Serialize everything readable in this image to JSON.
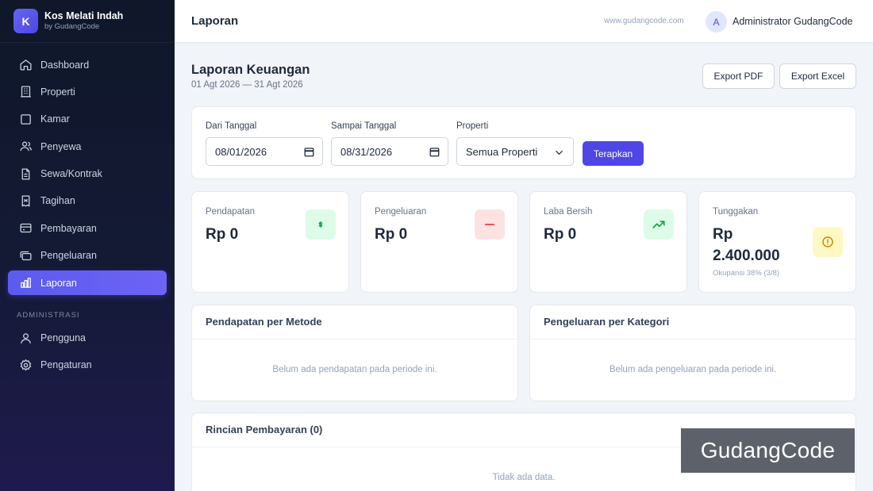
{
  "brand": {
    "logo_letter": "K",
    "name": "Kos Melati Indah",
    "sub": "by GudangCode"
  },
  "nav": {
    "items": [
      {
        "label": "Dashboard",
        "icon": "home-icon"
      },
      {
        "label": "Properti",
        "icon": "building-icon"
      },
      {
        "label": "Kamar",
        "icon": "square-icon"
      },
      {
        "label": "Penyewa",
        "icon": "users-icon"
      },
      {
        "label": "Sewa/Kontrak",
        "icon": "document-icon"
      },
      {
        "label": "Tagihan",
        "icon": "receipt-icon"
      },
      {
        "label": "Pembayaran",
        "icon": "credit-card-icon"
      },
      {
        "label": "Pengeluaran",
        "icon": "wallet-icon"
      },
      {
        "label": "Laporan",
        "icon": "bar-chart-icon",
        "active": true
      }
    ],
    "section_admin": "ADMINISTRASI",
    "admin_items": [
      {
        "label": "Pengguna",
        "icon": "user-icon"
      },
      {
        "label": "Pengaturan",
        "icon": "gear-icon"
      }
    ]
  },
  "header": {
    "title": "Laporan",
    "site": "www.gudangcode.com",
    "avatar_letter": "A",
    "user": "Administrator GudangCode"
  },
  "page": {
    "title": "Laporan Keuangan",
    "range": "01 Agt 2026 — 31 Agt 2026",
    "export_pdf": "Export PDF",
    "export_excel": "Export Excel"
  },
  "filters": {
    "from_label": "Dari Tanggal",
    "from_value": "08/01/2026",
    "to_label": "Sampai Tanggal",
    "to_value": "08/31/2026",
    "property_label": "Properti",
    "property_value": "Semua Properti",
    "apply": "Terapkan"
  },
  "stats": {
    "income": {
      "label": "Pendapatan",
      "value": "Rp 0",
      "icon": "money-icon",
      "color": "#16a34a",
      "bg": "#dcfce7"
    },
    "expense": {
      "label": "Pengeluaran",
      "value": "Rp 0",
      "icon": "minus-icon",
      "color": "#dc2626",
      "bg": "#fee2e2"
    },
    "profit": {
      "label": "Laba Bersih",
      "value": "Rp 0",
      "icon": "trending-up-icon",
      "color": "#16a34a",
      "bg": "#dcfce7"
    },
    "arrears": {
      "label": "Tunggakan",
      "value_line1": "Rp",
      "value_line2": "2.400.000",
      "sub": "Okupansi 38% (3/8)",
      "icon": "alert-circle-icon",
      "color": "#ca8a04",
      "bg": "#fef9c3"
    }
  },
  "panels": {
    "income_by_method": {
      "title": "Pendapatan per Metode",
      "empty": "Belum ada pendapatan pada periode ini."
    },
    "expense_by_category": {
      "title": "Pengeluaran per Kategori",
      "empty": "Belum ada pengeluaran pada periode ini."
    },
    "payment_details": {
      "title": "Rincian Pembayaran (0)",
      "empty": "Tidak ada data."
    }
  },
  "watermark": "GudangCode",
  "colors": {
    "accent": "#4f46e5",
    "sidebar_bg": "#0f1729",
    "page_bg": "#f1f5f9"
  }
}
